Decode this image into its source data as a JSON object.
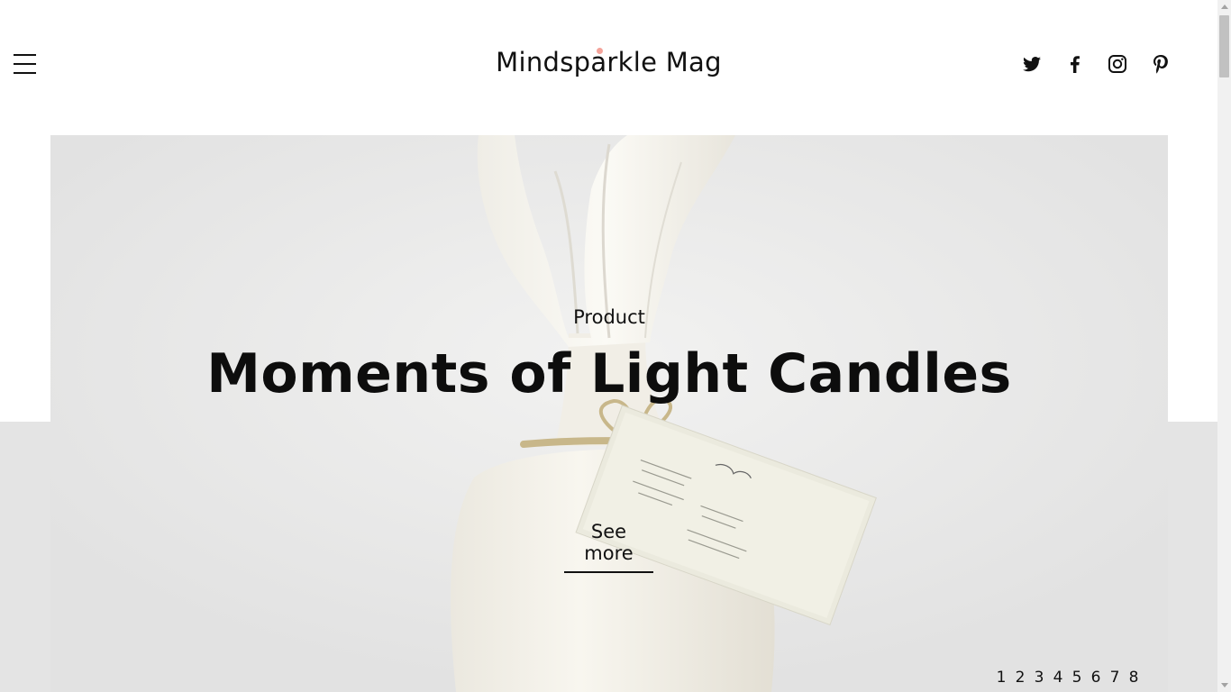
{
  "header": {
    "logo": "Mindsparkle Mag",
    "menu_icon": "hamburger-menu-icon",
    "social": [
      {
        "name": "twitter-icon"
      },
      {
        "name": "facebook-icon"
      },
      {
        "name": "instagram-icon"
      },
      {
        "name": "pinterest-icon"
      }
    ]
  },
  "hero": {
    "category": "Product",
    "title": "Moments of Light Candles",
    "cta": "See more",
    "pagination": [
      "1",
      "2",
      "3",
      "4",
      "5",
      "6",
      "7",
      "8"
    ]
  },
  "colors": {
    "logo_dot": "#f4a39a",
    "text": "#111111",
    "band": "#e4e4e4"
  }
}
